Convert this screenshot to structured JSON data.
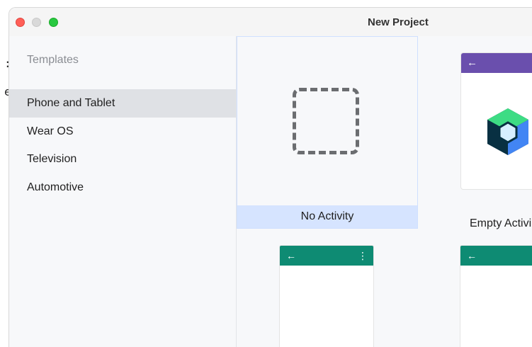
{
  "window": {
    "title": "New Project"
  },
  "stray_glyphs": [
    ":",
    "e"
  ],
  "sidebar": {
    "header": "Templates",
    "items": [
      {
        "label": "Phone and Tablet",
        "selected": true
      },
      {
        "label": "Wear OS",
        "selected": false
      },
      {
        "label": "Television",
        "selected": false
      },
      {
        "label": "Automotive",
        "selected": false
      }
    ]
  },
  "templates": {
    "no_activity": {
      "label": "No Activity",
      "selected": true,
      "icon": "dashed-square-icon"
    },
    "empty_activity": {
      "label": "Empty Activi",
      "appbar_icon": "←",
      "icon": "jetpack-compose-icon",
      "appbar_color": "#6a4fad"
    },
    "basic_activity": {
      "appbar_icon": "←",
      "menu_icon": "⋮",
      "appbar_color": "#0e8b73"
    },
    "fourth_activity": {
      "appbar_icon": "←",
      "appbar_color": "#0e8b73"
    }
  }
}
